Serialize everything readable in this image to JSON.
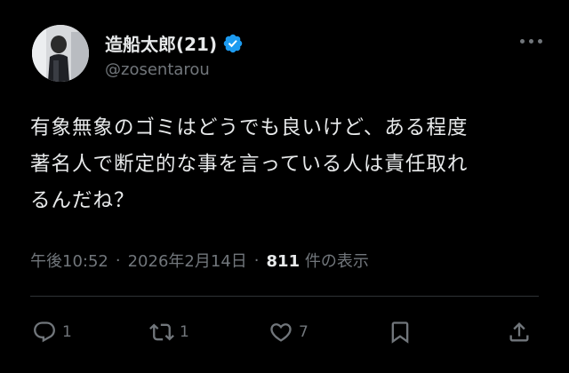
{
  "user": {
    "display_name": "造船太郎(21)",
    "handle": "@zosentarou"
  },
  "tweet": {
    "text": "有象無象のゴミはどうでも良いけど、ある程度\n著名人で断定的な事を言っている人は責任取れ\nるんだね？"
  },
  "meta": {
    "time": "午後10:52",
    "sep1": "·",
    "date": "2026年2月14日",
    "sep2": "·",
    "views": "811",
    "views_label": "件の表示"
  },
  "actions": {
    "reply_count": "1",
    "retweet_count": "1",
    "like_count": "7"
  },
  "icons": [
    "verified-badge-icon",
    "more-icon",
    "reply-icon",
    "retweet-icon",
    "like-icon",
    "bookmark-icon",
    "share-icon"
  ],
  "colors": {
    "background": "#000000",
    "text": "#e7e9ea",
    "secondary": "#71767b",
    "verified": "#1d9bf0"
  }
}
